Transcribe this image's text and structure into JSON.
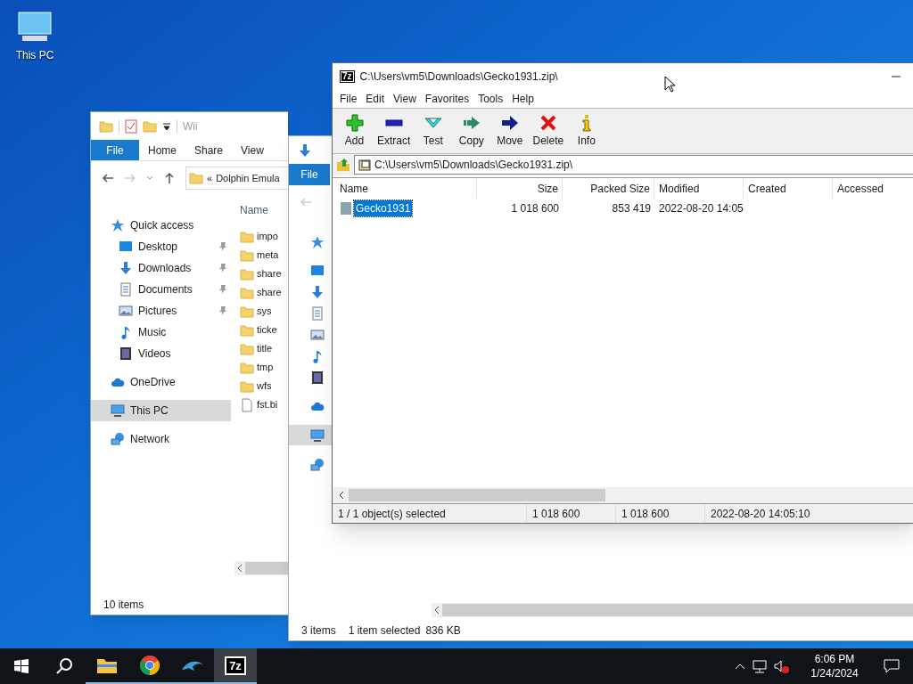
{
  "desktop_icons": [
    {
      "label": "This PC"
    }
  ],
  "explorer_back": {
    "title": "Wii",
    "ribbon_tabs": [
      {
        "label": "File",
        "selected": true
      },
      {
        "label": "Home",
        "selected": false
      },
      {
        "label": "Share",
        "selected": false
      },
      {
        "label": "View",
        "selected": false
      }
    ],
    "address": {
      "chevron": "«",
      "path": "Dolphin Emula"
    },
    "nav_pane": [
      {
        "label": "Quick access",
        "kind": "star",
        "selected": false,
        "children": [
          {
            "label": "Desktop",
            "kind": "desktop",
            "selected": false,
            "pinned": true
          },
          {
            "label": "Downloads",
            "kind": "download",
            "selected": false,
            "pinned": true
          },
          {
            "label": "Documents",
            "kind": "document",
            "selected": false,
            "pinned": true
          },
          {
            "label": "Pictures",
            "kind": "pictures",
            "selected": false,
            "pinned": true
          },
          {
            "label": "Music",
            "kind": "music",
            "selected": false,
            "pinned": false
          },
          {
            "label": "Videos",
            "kind": "videos",
            "selected": false,
            "pinned": false
          }
        ]
      },
      {
        "label": "OneDrive",
        "kind": "cloud",
        "selected": false
      },
      {
        "label": "This PC",
        "kind": "pc",
        "selected": true
      },
      {
        "label": "Network",
        "kind": "network",
        "selected": false
      }
    ],
    "column_header": "Name",
    "files": [
      {
        "name": "impo",
        "kind": "folder"
      },
      {
        "name": "meta",
        "kind": "folder"
      },
      {
        "name": "share",
        "kind": "folder"
      },
      {
        "name": "share",
        "kind": "folder"
      },
      {
        "name": "sys",
        "kind": "folder"
      },
      {
        "name": "ticke",
        "kind": "folder"
      },
      {
        "name": "title",
        "kind": "folder"
      },
      {
        "name": "tmp",
        "kind": "folder"
      },
      {
        "name": "wfs",
        "kind": "folder"
      },
      {
        "name": "fst.bi",
        "kind": "file"
      }
    ],
    "status_bar": "10 items"
  },
  "explorer_front": {
    "ribbon_tabs": [
      {
        "label": "File",
        "selected": true
      }
    ],
    "nav_pane": [
      {
        "kind": "star",
        "selected": false
      },
      {
        "kind": "desktop",
        "selected": false
      },
      {
        "kind": "download",
        "selected": false
      },
      {
        "kind": "document",
        "selected": false
      },
      {
        "kind": "pictures",
        "selected": false
      },
      {
        "kind": "music",
        "selected": false
      },
      {
        "kind": "videos",
        "selected": false
      },
      {
        "kind": "cloud",
        "selected": false
      },
      {
        "kind": "pc",
        "selected": true
      },
      {
        "kind": "network",
        "selected": false
      }
    ],
    "status_bar": [
      "3 items",
      "1 item selected",
      "836 KB"
    ]
  },
  "archive_window": {
    "icon_text": "7z",
    "title": "C:\\Users\\vm5\\Downloads\\Gecko1931.zip\\",
    "menu": [
      "File",
      "Edit",
      "View",
      "Favorites",
      "Tools",
      "Help"
    ],
    "toolbar": [
      {
        "label": "Add",
        "kind": "add"
      },
      {
        "label": "Extract",
        "kind": "extract"
      },
      {
        "label": "Test",
        "kind": "test"
      },
      {
        "label": "Copy",
        "kind": "copy"
      },
      {
        "label": "Move",
        "kind": "move"
      },
      {
        "label": "Delete",
        "kind": "delete"
      },
      {
        "label": "Info",
        "kind": "info"
      }
    ],
    "address": "C:\\Users\\vm5\\Downloads\\Gecko1931.zip\\",
    "table": {
      "columns": [
        "Name",
        "Size",
        "Packed Size",
        "Modified",
        "Created",
        "Accessed"
      ],
      "rows": [
        {
          "values": [
            "Gecko1931",
            "1 018 600",
            "853 419",
            "2022-08-20 14:05"
          ],
          "selected": true
        }
      ]
    },
    "status_bar": [
      "1 / 1 object(s) selected",
      "1 018 600",
      "1 018 600",
      "2022-08-20 14:05:10"
    ]
  },
  "taskbar": {
    "apps": [
      {
        "kind": "explorer",
        "selected": false
      },
      {
        "kind": "chrome",
        "selected": false
      },
      {
        "kind": "dolphin",
        "selected": false
      },
      {
        "kind": "archiver",
        "label": "7z",
        "selected": true
      }
    ],
    "clock": {
      "time": "6:06 PM",
      "date": "1/24/2024"
    }
  }
}
